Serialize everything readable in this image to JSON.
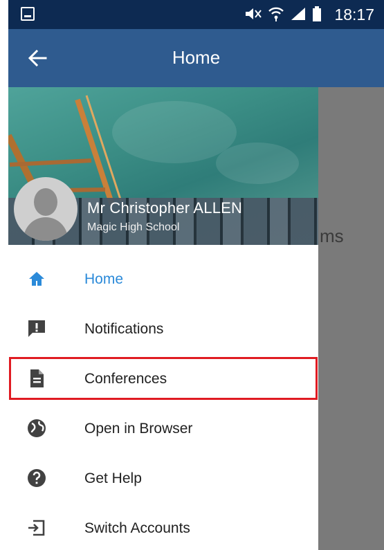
{
  "status_bar": {
    "time": "18:17"
  },
  "app_bar": {
    "title": "Home"
  },
  "background": {
    "peek_text": "ms"
  },
  "drawer": {
    "user": {
      "name": "Mr Christopher ALLEN",
      "school": "Magic High School"
    },
    "menu_items": [
      {
        "label": "Home",
        "icon": "home-icon",
        "active": true
      },
      {
        "label": "Notifications",
        "icon": "alert-icon",
        "active": false
      },
      {
        "label": "Conferences",
        "icon": "document-icon",
        "active": false,
        "highlighted": true
      },
      {
        "label": "Open in Browser",
        "icon": "globe-icon",
        "active": false
      },
      {
        "label": "Get Help",
        "icon": "help-icon",
        "active": false
      },
      {
        "label": "Switch Accounts",
        "icon": "switch-account-icon",
        "active": false
      }
    ]
  },
  "colors": {
    "status_bar": "#0d2a52",
    "app_bar": "#2f5b8f",
    "active": "#2b8ad9",
    "highlight": "#e01b22",
    "icon": "#424242"
  }
}
